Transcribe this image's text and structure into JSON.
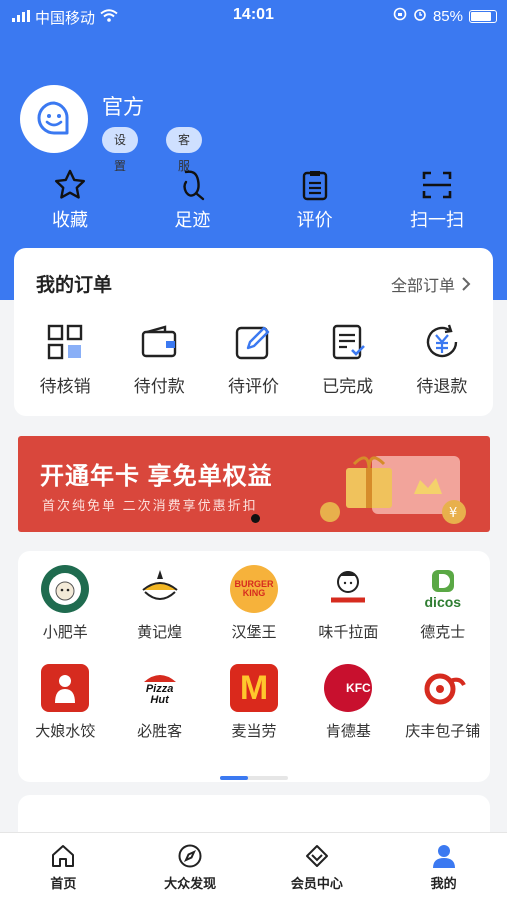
{
  "status_bar": {
    "carrier": "中国移动",
    "time": "14:01",
    "battery": "85%",
    "battery_level": 0.85
  },
  "profile": {
    "name": "官方",
    "settings_label": "设置",
    "service_label": "客服"
  },
  "quick_actions": [
    {
      "label": "收藏",
      "icon": "star-icon"
    },
    {
      "label": "足迹",
      "icon": "footprint-icon"
    },
    {
      "label": "评价",
      "icon": "clipboard-icon"
    },
    {
      "label": "扫一扫",
      "icon": "scan-icon"
    }
  ],
  "orders": {
    "title": "我的订单",
    "all_label": "全部订单",
    "items": [
      {
        "label": "待核销",
        "icon": "qrcode-icon"
      },
      {
        "label": "待付款",
        "icon": "wallet-icon"
      },
      {
        "label": "待评价",
        "icon": "edit-icon"
      },
      {
        "label": "已完成",
        "icon": "completed-doc-icon"
      },
      {
        "label": "待退款",
        "icon": "refund-icon"
      }
    ]
  },
  "banner": {
    "title": "开通年卡 享免单权益",
    "subtitle": "首次纯免单 二次消费享优惠折扣"
  },
  "brands": [
    {
      "label": "小肥羊",
      "icon": "sheep-logo-icon"
    },
    {
      "label": "黄记煌",
      "icon": "pot-logo-icon"
    },
    {
      "label": "汉堡王",
      "icon": "burger-king-logo-icon",
      "logo_text": "BURGER KING"
    },
    {
      "label": "味千拉面",
      "icon": "ajisen-logo-icon"
    },
    {
      "label": "德克士",
      "icon": "dicos-logo-icon",
      "logo_text": "dicos"
    },
    {
      "label": "大娘水饺",
      "icon": "dumpling-logo-icon"
    },
    {
      "label": "必胜客",
      "icon": "pizza-hut-logo-icon",
      "logo_text": "Pizza Hut"
    },
    {
      "label": "麦当劳",
      "icon": "mcdonalds-logo-icon",
      "logo_text": "M"
    },
    {
      "label": "肯德基",
      "icon": "kfc-logo-icon",
      "logo_text": "KFC"
    },
    {
      "label": "庆丰包子铺",
      "icon": "qingfeng-logo-icon"
    }
  ],
  "tabbar": [
    {
      "label": "首页",
      "icon": "home-icon"
    },
    {
      "label": "大众发现",
      "icon": "compass-icon"
    },
    {
      "label": "会员中心",
      "icon": "diamond-icon"
    },
    {
      "label": "我的",
      "icon": "user-icon"
    }
  ],
  "colors": {
    "primary": "#3b79f1",
    "banner": "#d9473c",
    "page_bg": "#f3f4f6"
  }
}
